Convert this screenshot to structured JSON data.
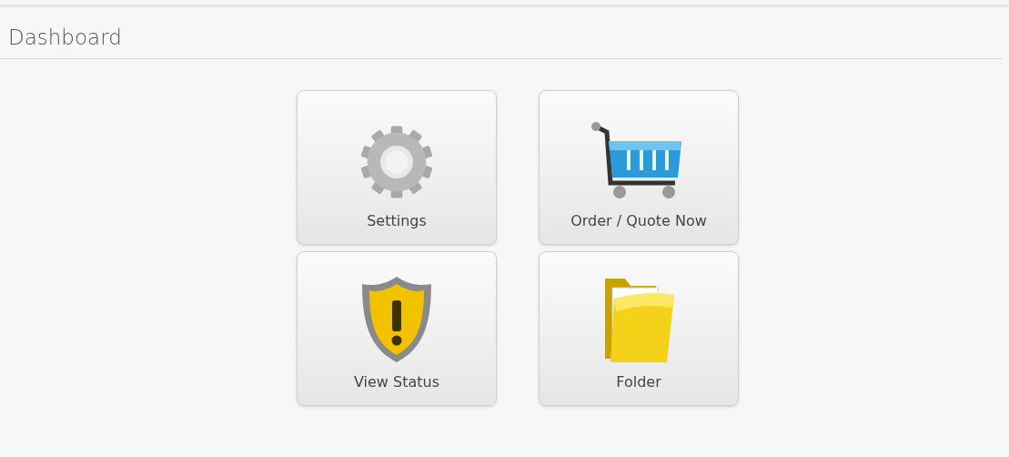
{
  "page": {
    "title": "Dashboard"
  },
  "tiles": [
    {
      "kind": "gear",
      "label": "Settings"
    },
    {
      "kind": "cart",
      "label": "Order / Quote Now"
    },
    {
      "kind": "shield",
      "label": "View Status"
    },
    {
      "kind": "folder",
      "label": "Folder"
    }
  ]
}
